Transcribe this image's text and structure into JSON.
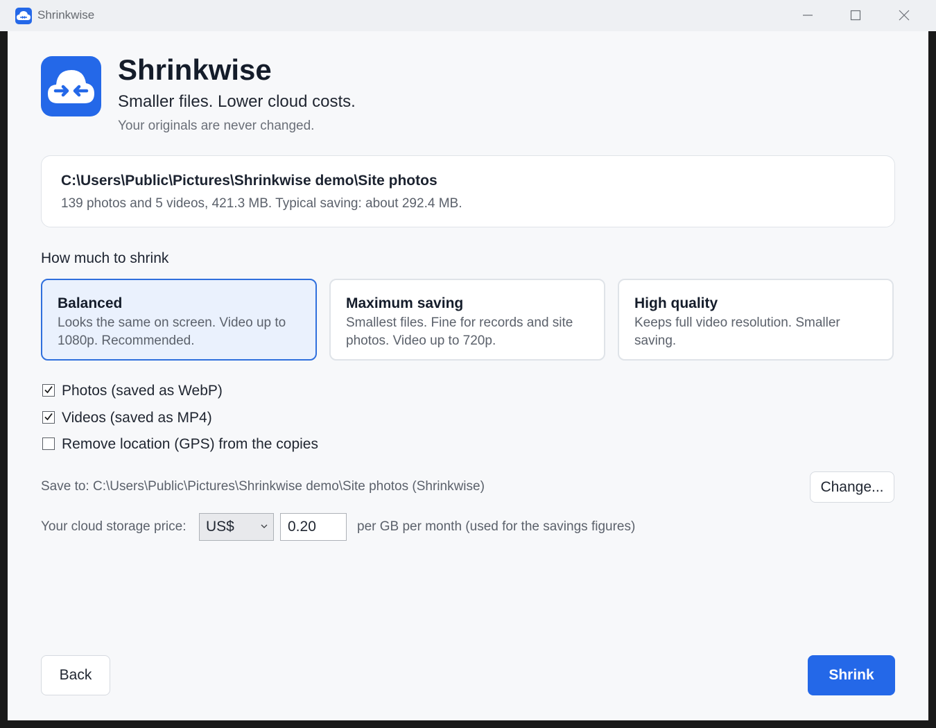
{
  "window": {
    "title": "Shrinkwise",
    "controls": [
      "minimize",
      "maximize",
      "close"
    ]
  },
  "header": {
    "app_name": "Shrinkwise",
    "tagline": "Smaller files. Lower cloud costs.",
    "subline": "Your originals are never changed."
  },
  "folder": {
    "path": "C:\\Users\\Public\\Pictures\\Shrinkwise demo\\Site photos",
    "stats": "139 photos and 5 videos, 421.3 MB.  Typical saving: about 292.4 MB."
  },
  "presets": {
    "label": "How much to shrink",
    "selected": "Balanced",
    "items": [
      {
        "title": "Balanced",
        "desc": "Looks the same on screen. Video up to 1080p. Recommended."
      },
      {
        "title": "Maximum saving",
        "desc": "Smallest files. Fine for records and site photos. Video up to 720p."
      },
      {
        "title": "High quality",
        "desc": "Keeps full video resolution. Smaller saving."
      }
    ]
  },
  "options": [
    {
      "label": "Photos (saved as WebP)",
      "checked": true
    },
    {
      "label": "Videos (saved as MP4)",
      "checked": true
    },
    {
      "label": "Remove location (GPS) from the copies",
      "checked": false
    }
  ],
  "save": {
    "label": "Save to: C:\\Users\\Public\\Pictures\\Shrinkwise demo\\Site photos (Shrinkwise)",
    "change_label": "Change..."
  },
  "price": {
    "label": "Your cloud storage price:",
    "currency": "US$",
    "value": "0.20",
    "suffix": "per GB per month (used for the savings figures)"
  },
  "footer": {
    "back_label": "Back",
    "shrink_label": "Shrink"
  },
  "colors": {
    "accent": "#2468e8",
    "selected_bg": "#eaf1fd",
    "selected_border": "#2f6fdd"
  },
  "icons": {
    "app": "cloud-arrows-icon",
    "checkbox": "checkmark-icon",
    "dropdown": "chevron-down-icon"
  }
}
